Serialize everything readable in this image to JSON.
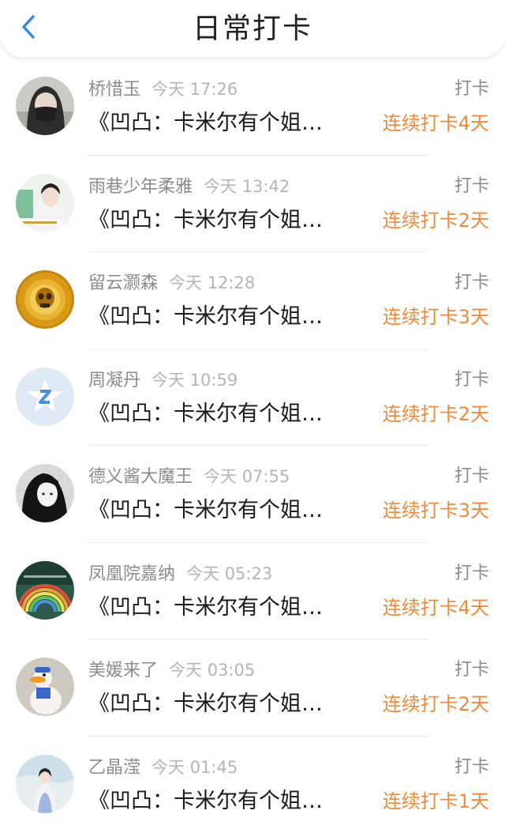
{
  "header": {
    "title": "日常打卡",
    "back_icon": "chevron-left-icon",
    "accent_color": "#2f8ae8"
  },
  "colors": {
    "streak": "#f08a3c",
    "meta": "#8c8c8c",
    "time": "#b5b5b5"
  },
  "items": [
    {
      "name": "桥惜玉",
      "time": "今天 17:26",
      "action": "打卡",
      "content": "《凹凸：卡米尔有个姐…",
      "streak": "连续打卡4天",
      "avatar": "avatar-masked-girl"
    },
    {
      "name": "雨巷少年柔雅",
      "time": "今天 13:42",
      "action": "打卡",
      "content": "《凹凸：卡米尔有个姐…",
      "streak": "连续打卡2天",
      "avatar": "avatar-girl-photo"
    },
    {
      "name": "留云灏森",
      "time": "今天 12:28",
      "action": "打卡",
      "content": "《凹凸：卡米尔有个姐…",
      "streak": "连续打卡3天",
      "avatar": "avatar-golden-skull"
    },
    {
      "name": "周凝丹",
      "time": "今天 10:59",
      "action": "打卡",
      "content": "《凹凸：卡米尔有个姐…",
      "streak": "连续打卡2天",
      "avatar": "avatar-default-star"
    },
    {
      "name": "德义酱大魔王",
      "time": "今天 07:55",
      "action": "打卡",
      "content": "《凹凸：卡米尔有个姐…",
      "streak": "连续打卡3天",
      "avatar": "avatar-bw-girl"
    },
    {
      "name": "凤凰院嘉纳",
      "time": "今天 05:23",
      "action": "打卡",
      "content": "《凹凸：卡米尔有个姐…",
      "streak": "连续打卡4天",
      "avatar": "avatar-rainbow"
    },
    {
      "name": "美媛来了",
      "time": "今天 03:05",
      "action": "打卡",
      "content": "《凹凸：卡米尔有个姐…",
      "streak": "连续打卡2天",
      "avatar": "avatar-duck-toy"
    },
    {
      "name": "乙晶滢",
      "time": "今天 01:45",
      "action": "打卡",
      "content": "《凹凸：卡米尔有个姐…",
      "streak": "连续打卡1天",
      "avatar": "avatar-hanfu-girl"
    }
  ]
}
